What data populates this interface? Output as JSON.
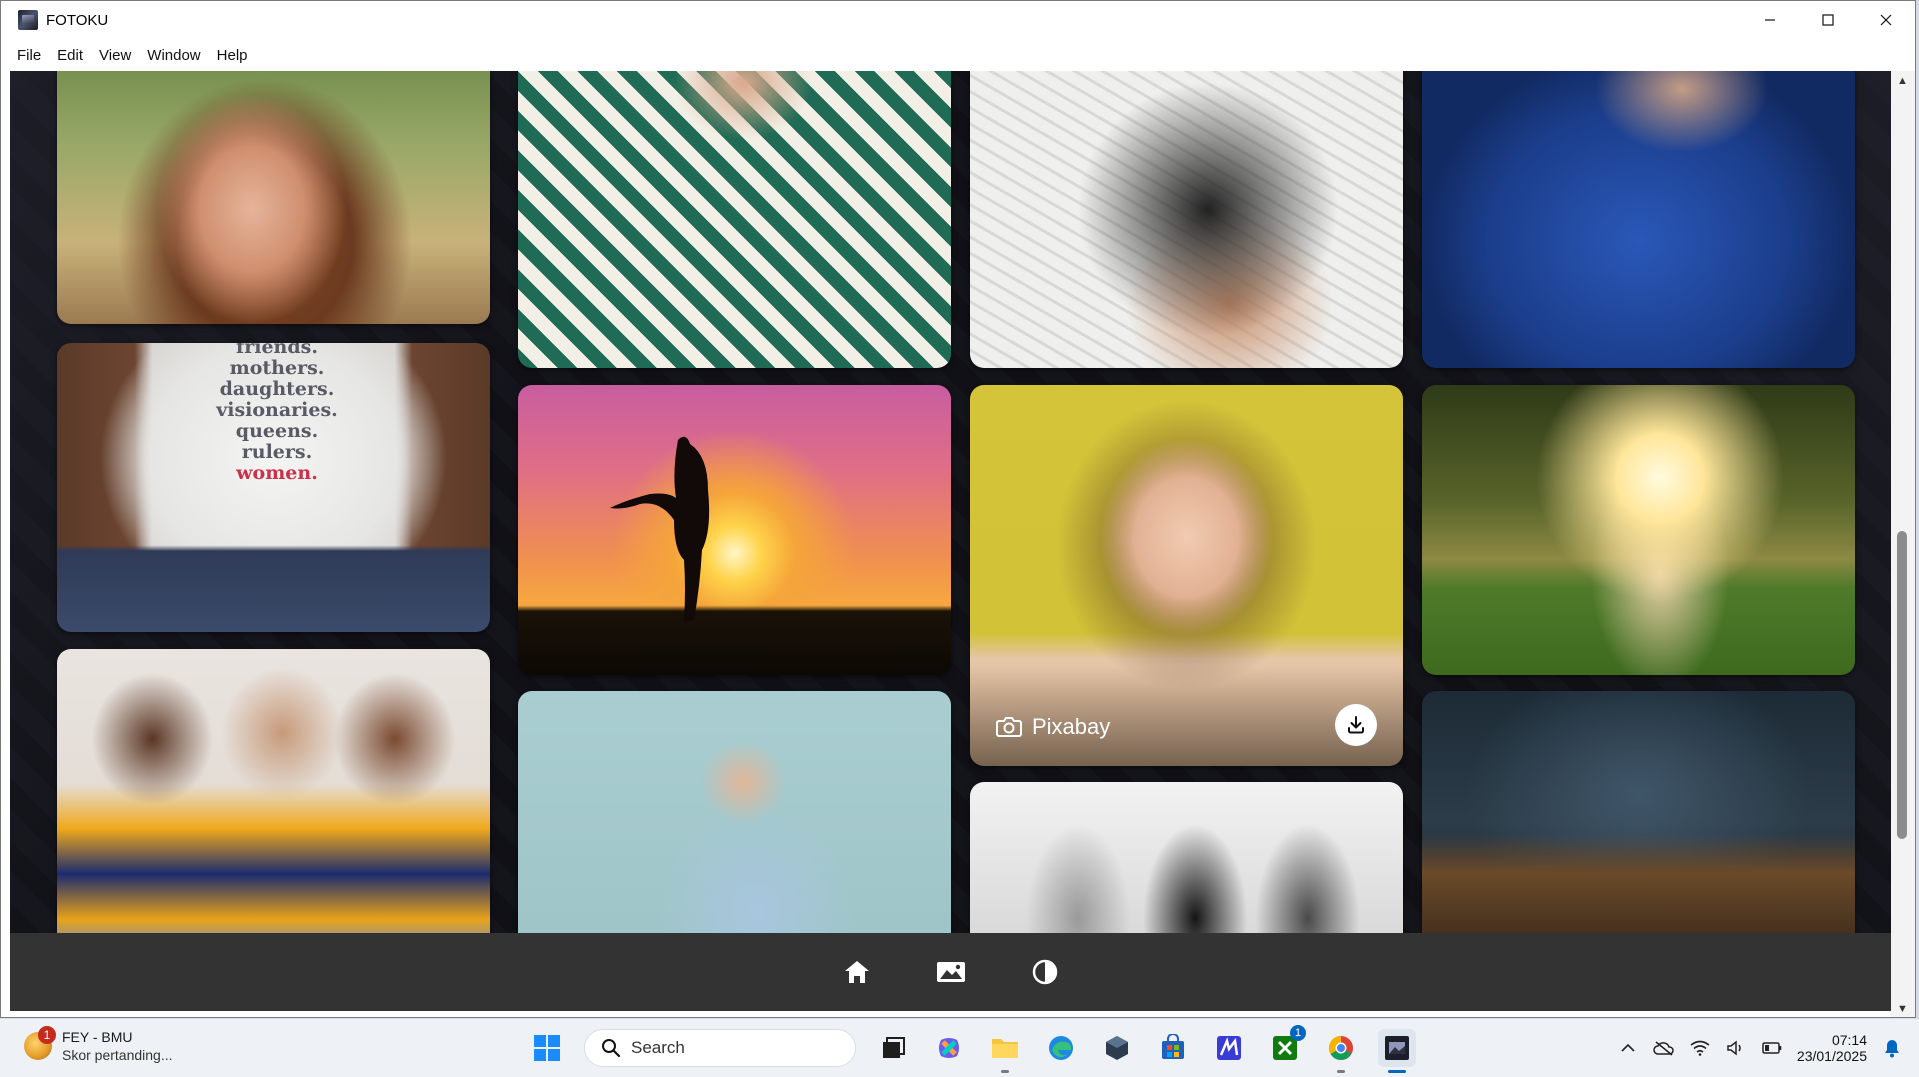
{
  "window": {
    "title": "FOTOKU",
    "minimize": "minimize",
    "maximize": "maximize",
    "close": "close"
  },
  "menu": [
    "File",
    "Edit",
    "View",
    "Window",
    "Help"
  ],
  "gallery": {
    "featured_photo": {
      "source": "Pixabay"
    },
    "tshirt_text": [
      "friends.",
      "mothers.",
      "daughters.",
      "visionaries.",
      "queens.",
      "rulers.",
      "women."
    ]
  },
  "bottom_nav": {
    "items": [
      {
        "name": "home",
        "icon": "home-icon"
      },
      {
        "name": "gallery",
        "icon": "image-icon"
      },
      {
        "name": "theme",
        "icon": "contrast-icon"
      }
    ]
  },
  "taskbar": {
    "widget": {
      "title": "FEY - BMU",
      "subtitle": "Skor pertanding...",
      "badge": "1"
    },
    "search_placeholder": "Search",
    "xbox_badge": "1",
    "clock": {
      "time": "07:14",
      "date": "23/01/2025"
    }
  },
  "colors": {
    "accent": "#0067c0",
    "content_bg": "#0d0d12",
    "nav_bg": "#333333"
  }
}
